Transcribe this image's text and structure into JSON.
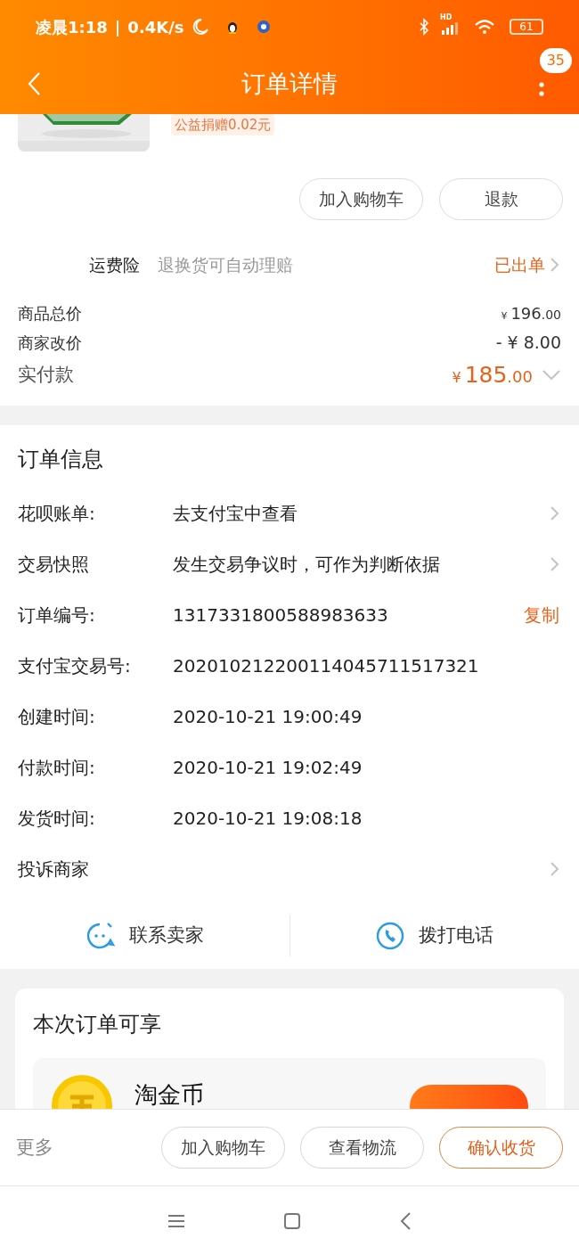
{
  "status_bar": {
    "time": "凌晨1:18",
    "separator": "|",
    "speed": "0.4K/s",
    "network": "HD",
    "battery": "61"
  },
  "header": {
    "title": "订单详情",
    "badge": "35"
  },
  "product": {
    "donation_tag": "公益捐赠0.02元"
  },
  "item_actions": [
    "加入购物车",
    "退款"
  ],
  "insurance": {
    "label": "运费险",
    "description": "退换货可自动理赔",
    "status": "已出单"
  },
  "prices": [
    {
      "kind": "split",
      "label": "商品总价",
      "currency": "¥",
      "integer": "196",
      "decimal": ".00"
    },
    {
      "kind": "plain",
      "label": "商家改价",
      "amount": "- ¥ 8.00"
    },
    {
      "kind": "paid",
      "label": "实付款",
      "currency": "¥",
      "integer": "185",
      "decimal": ".00",
      "expanded": false
    }
  ],
  "order_info": {
    "title": "订单信息",
    "rows": [
      {
        "label": "花呗账单:",
        "value": "去支付宝中查看",
        "chevron": true
      },
      {
        "label": "交易快照",
        "value": "发生交易争议时，可作为判断依据",
        "chevron": true
      },
      {
        "label": "订单编号:",
        "value": "1317331800588983633",
        "action": "复制",
        "chevron": false
      },
      {
        "label": "支付宝交易号:",
        "value": "202010212200114045711517321",
        "chevron": false
      },
      {
        "label": "创建时间:",
        "value": "2020-10-21 19:00:49",
        "chevron": false
      },
      {
        "label": "付款时间:",
        "value": "2020-10-21 19:02:49",
        "chevron": false
      },
      {
        "label": "发货时间:",
        "value": "2020-10-21 19:08:18",
        "chevron": false
      },
      {
        "label": "投诉商家",
        "chevron": true
      }
    ]
  },
  "contact": [
    {
      "kind": "chat",
      "label": "联系卖家"
    },
    {
      "kind": "phone",
      "label": "拨打电话"
    }
  ],
  "benefits": {
    "title": "本次订单可享",
    "items": [
      {
        "name": "淘金币"
      }
    ]
  },
  "bottom_bar": {
    "more": "更多",
    "buttons": [
      {
        "label": "加入购物车",
        "primary": false
      },
      {
        "label": "查看物流",
        "primary": false
      },
      {
        "label": "确认收货",
        "primary": true
      }
    ]
  }
}
